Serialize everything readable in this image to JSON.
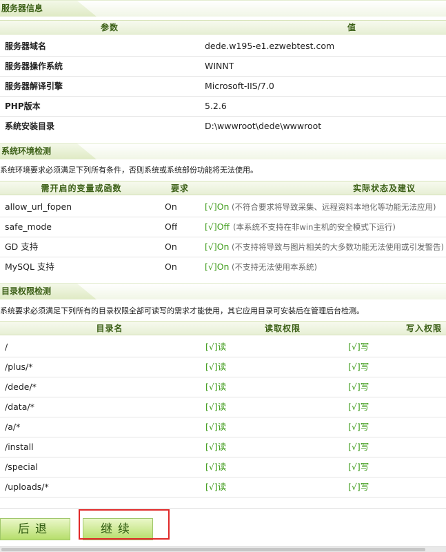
{
  "server": {
    "title": "服务器信息",
    "col_param": "参数",
    "col_value": "值",
    "rows": [
      {
        "label": "服务器域名",
        "value": "dede.w195-e1.ezwebtest.com"
      },
      {
        "label": "服务器操作系统",
        "value": "WINNT"
      },
      {
        "label": "服务器解译引擎",
        "value": "Microsoft-IIS/7.0"
      },
      {
        "label": "PHP版本",
        "value": "5.2.6"
      },
      {
        "label": "系统安装目录",
        "value": "D:\\wwwroot\\dede\\wwwroot"
      }
    ]
  },
  "env": {
    "title": "系统环境检测",
    "note": "系统环境要求必须满足下列所有条件，否则系统或系统部份功能将无法使用。",
    "col_var": "需开启的变量或函数",
    "col_req": "要求",
    "col_status": "实际状态及建议",
    "rows": [
      {
        "name": "allow_url_fopen",
        "req": "On",
        "status": "[√]On",
        "advice": "(不符合要求将导致采集、远程资料本地化等功能无法应用)"
      },
      {
        "name": "safe_mode",
        "req": "Off",
        "status": "[√]Off",
        "advice": "(本系统不支持在非win主机的安全模式下运行)"
      },
      {
        "name": "GD 支持",
        "req": "On",
        "status": "[√]On",
        "advice": "(不支持将导致与图片相关的大多数功能无法使用或引发警告)"
      },
      {
        "name": "MySQL 支持",
        "req": "On",
        "status": "[√]On",
        "advice": "(不支持无法使用本系统)"
      }
    ]
  },
  "dirs": {
    "title": "目录权限检测",
    "note": "系统要求必须满足下列所有的目录权限全部可读写的需求才能使用，其它应用目录可安装后在管理后台检测。",
    "col_name": "目录名",
    "col_read": "读取权限",
    "col_write": "写入权限",
    "rows": [
      {
        "path": "/",
        "read": "[√]读",
        "write": "[√]写"
      },
      {
        "path": "/plus/*",
        "read": "[√]读",
        "write": "[√]写"
      },
      {
        "path": "/dede/*",
        "read": "[√]读",
        "write": "[√]写"
      },
      {
        "path": "/data/*",
        "read": "[√]读",
        "write": "[√]写"
      },
      {
        "path": "/a/*",
        "read": "[√]读",
        "write": "[√]写"
      },
      {
        "path": "/install",
        "read": "[√]读",
        "write": "[√]写"
      },
      {
        "path": "/special",
        "read": "[√]读",
        "write": "[√]写"
      },
      {
        "path": "/uploads/*",
        "read": "[√]读",
        "write": "[√]写"
      }
    ]
  },
  "buttons": {
    "back": "后退",
    "continue": "继续"
  },
  "colors": {
    "accent_green": "#3c9a17",
    "header_green": "#3b5f16",
    "focus_red": "#e02828"
  }
}
